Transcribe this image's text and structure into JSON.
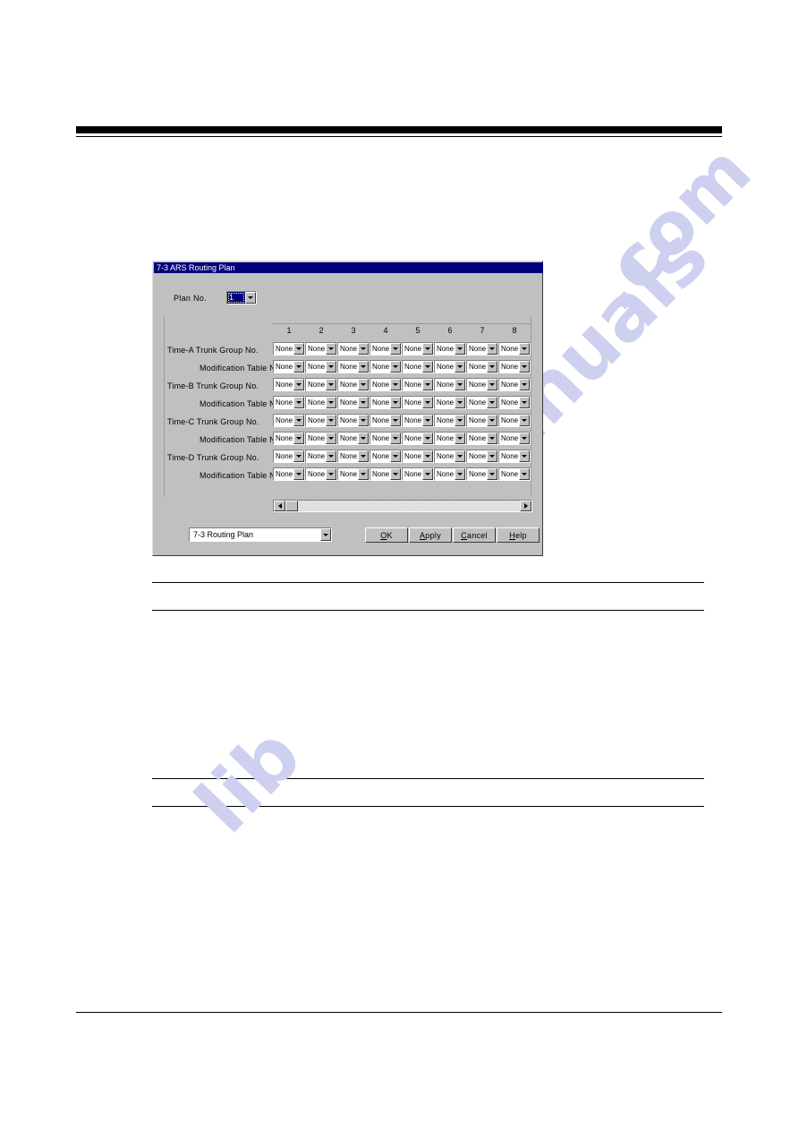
{
  "page": {
    "watermark_text": "manualslib.com",
    "watermark_words": [
      "manuals",
      "lib",
      ".com"
    ]
  },
  "dialog": {
    "title": "7-3 ARS Routing Plan",
    "plan": {
      "label": "Plan No.",
      "value": "1"
    },
    "grid": {
      "column_headers": [
        "1",
        "2",
        "3",
        "4",
        "5",
        "6",
        "7",
        "8"
      ],
      "cell_value": "None",
      "rows": [
        {
          "label": "Time-A  Trunk Group No.",
          "indent": false,
          "values": [
            "None",
            "None",
            "None",
            "None",
            "None",
            "None",
            "None",
            "None"
          ]
        },
        {
          "label": "Modification Table No.",
          "indent": true,
          "values": [
            "None",
            "None",
            "None",
            "None",
            "None",
            "None",
            "None",
            "None"
          ]
        },
        {
          "label": "Time-B  Trunk Group No.",
          "indent": false,
          "values": [
            "None",
            "None",
            "None",
            "None",
            "None",
            "None",
            "None",
            "None"
          ]
        },
        {
          "label": "Modification Table No.",
          "indent": true,
          "values": [
            "None",
            "None",
            "None",
            "None",
            "None",
            "None",
            "None",
            "None"
          ]
        },
        {
          "label": "Time-C  Trunk Group No.",
          "indent": false,
          "values": [
            "None",
            "None",
            "None",
            "None",
            "None",
            "None",
            "None",
            "None"
          ]
        },
        {
          "label": "Modification Table No.",
          "indent": true,
          "values": [
            "None",
            "None",
            "None",
            "None",
            "None",
            "None",
            "None",
            "None"
          ]
        },
        {
          "label": "Time-D  Trunk Group No.",
          "indent": false,
          "values": [
            "None",
            "None",
            "None",
            "None",
            "None",
            "None",
            "None",
            "None"
          ]
        },
        {
          "label": "Modification Table No.",
          "indent": true,
          "values": [
            "None",
            "None",
            "None",
            "None",
            "None",
            "None",
            "None",
            "None"
          ]
        }
      ]
    },
    "scrollbar": {
      "left_arrow": "scroll-left-icon",
      "right_arrow": "scroll-right-icon"
    },
    "footer": {
      "nav_combo_value": "7-3 Routing Plan",
      "buttons": [
        {
          "mnemonic": "O",
          "rest": "K"
        },
        {
          "mnemonic": "A",
          "rest": "pply"
        },
        {
          "mnemonic": "C",
          "rest": "ancel"
        },
        {
          "mnemonic": "H",
          "rest": "elp"
        }
      ]
    }
  },
  "colors": {
    "titlebar": "#00007b",
    "dialog_face": "#c0c0c0",
    "field": "#ffffff",
    "watermark": "#cdd0ee"
  }
}
